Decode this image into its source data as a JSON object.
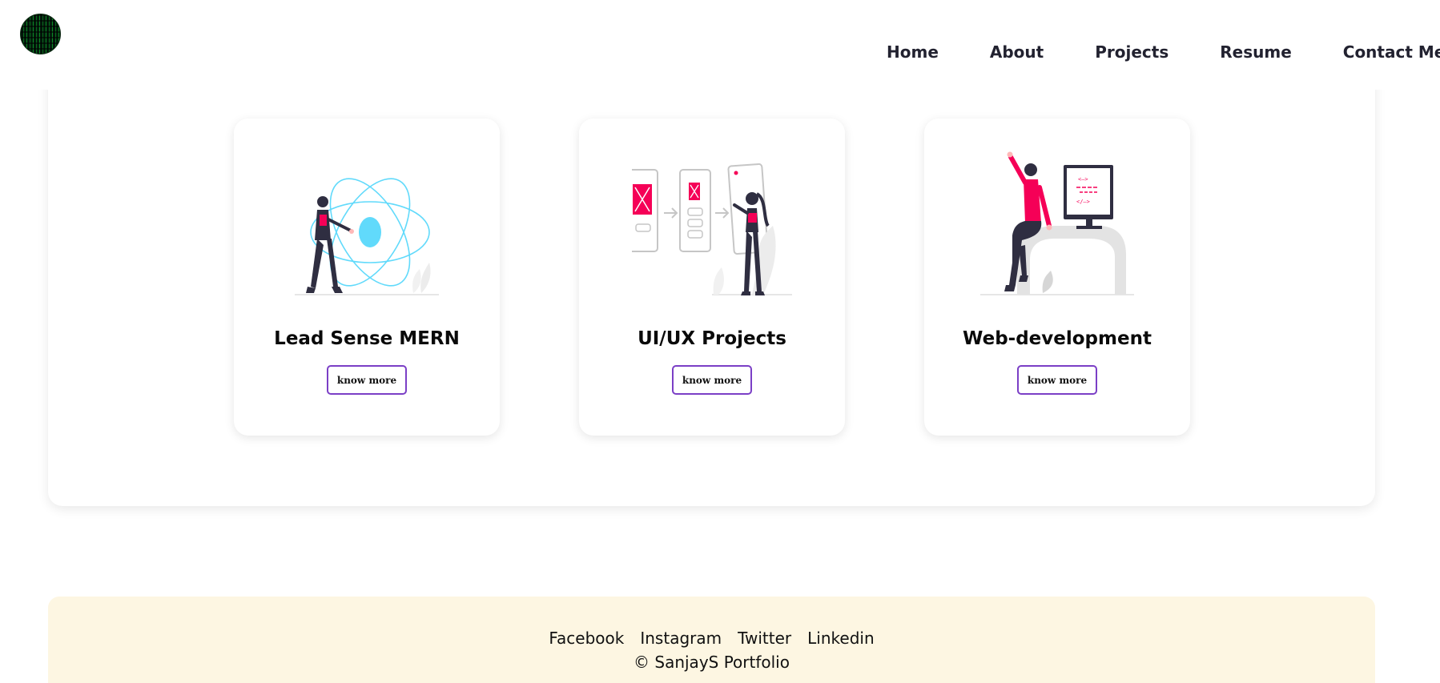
{
  "nav": {
    "logo": "matrix-rain-avatar",
    "links": [
      "Home",
      "About",
      "Projects",
      "Resume",
      "Contact Me"
    ]
  },
  "projects": [
    {
      "title": "Lead Sense MERN",
      "button": "know more",
      "illustration": "react-atom-illustration"
    },
    {
      "title": "UI/UX Projects",
      "button": "know more",
      "illustration": "wireframe-flow-illustration"
    },
    {
      "title": "Web-development",
      "button": "know more",
      "illustration": "developer-monitor-illustration"
    }
  ],
  "footer": {
    "social": [
      "Facebook",
      "Instagram",
      "Twitter",
      "Linkedin"
    ],
    "copyright": "© SanjayS Portfolio"
  },
  "colors": {
    "accent_border": "#7b3fc6",
    "react_blue": "#61dafb",
    "pink": "#f50057",
    "footer_bg": "#fdf6e2"
  }
}
